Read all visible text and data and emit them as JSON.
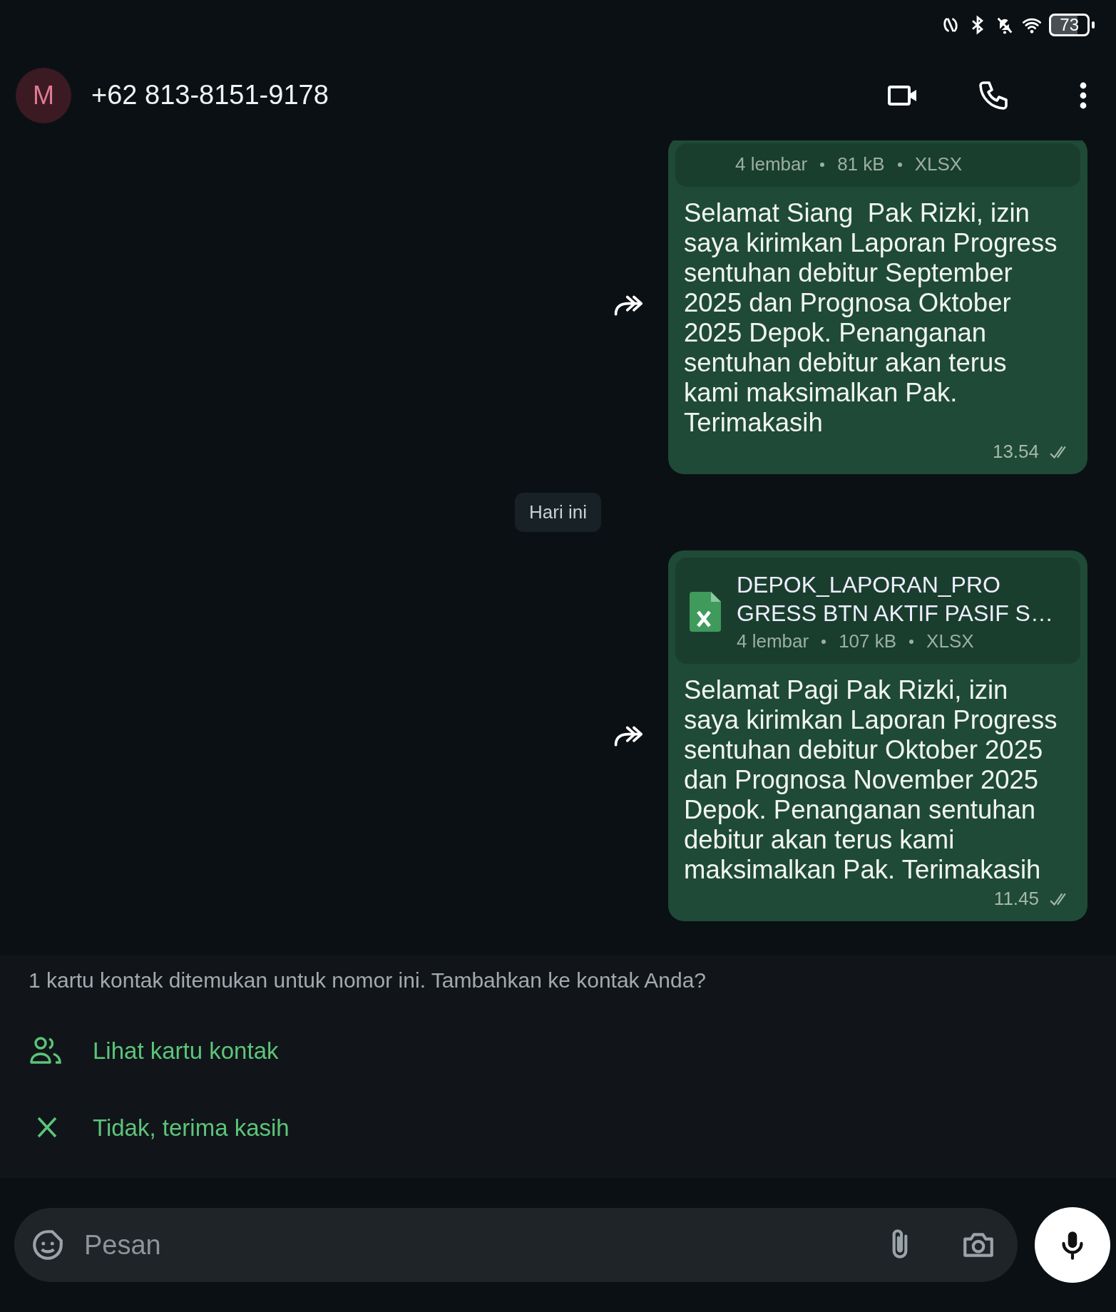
{
  "status_bar": {
    "battery": "73"
  },
  "header": {
    "avatar_letter": "M",
    "title": "+62 813-8151-9178"
  },
  "chat": [
    {
      "kind": "message",
      "forwardable": true,
      "file": {
        "meta": [
          "4 lembar",
          "81 kB",
          "XLSX"
        ]
      },
      "text": "Selamat Siang  Pak Rizki, izin saya kirimkan Laporan Progress sentuhan debitur September 2025 dan Prognosa Oktober 2025 Depok. Penanganan sentuhan debitur akan terus kami maksimalkan Pak. Terimakasih",
      "time": "13.54",
      "read": false
    },
    {
      "kind": "date",
      "label": "Hari ini"
    },
    {
      "kind": "message",
      "forwardable": true,
      "file": {
        "name": "DEPOK_LAPORAN_PRO GRESS BTN AKTIF PASIF S…",
        "meta": [
          "4 lembar",
          "107 kB",
          "XLSX"
        ]
      },
      "text": "Selamat Pagi Pak Rizki, izin saya kirimkan Laporan Progress sentuhan debitur Oktober 2025 dan Prognosa November 2025 Depok. Penanganan sentuhan debitur akan terus kami maksimalkan Pak. Terimakasih",
      "time": "11.45",
      "read": false
    }
  ],
  "contact_banner": {
    "text": "1 kartu kontak ditemukan untuk nomor ini. Tambahkan ke kontak Anda?",
    "actions": [
      {
        "kind": "view_contact",
        "label": "Lihat kartu kontak"
      },
      {
        "kind": "dismiss",
        "label": "Tidak, terima kasih"
      }
    ]
  },
  "composer": {
    "placeholder": "Pesan"
  }
}
